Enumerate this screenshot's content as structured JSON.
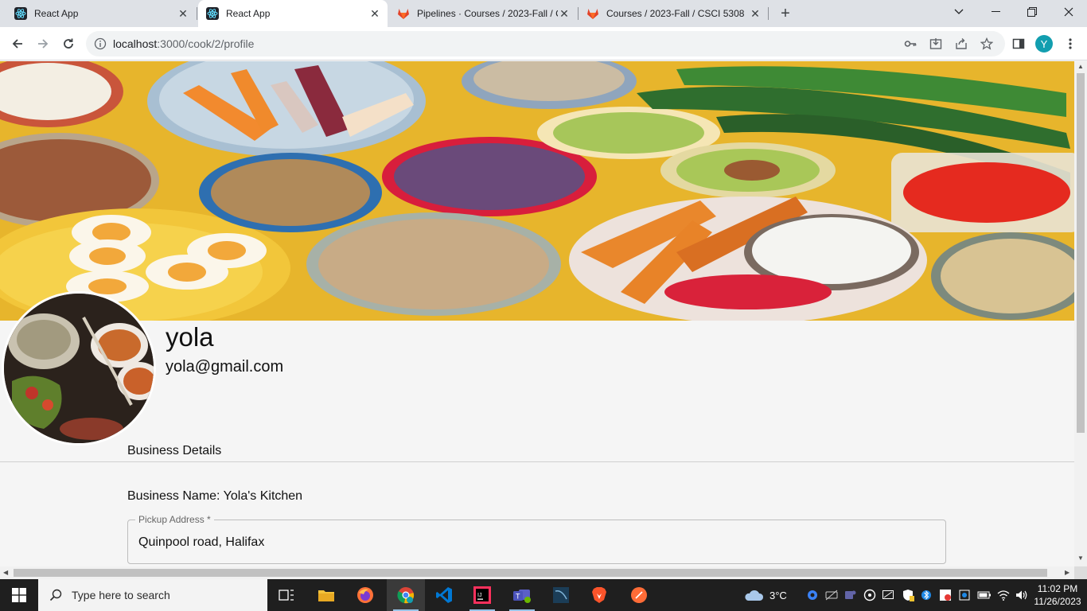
{
  "browser": {
    "tabs": [
      {
        "title": "React App",
        "active": false
      },
      {
        "title": "React App",
        "active": true
      },
      {
        "title": "Pipelines · Courses / 2023-Fall / C",
        "active": false
      },
      {
        "title": "Courses / 2023-Fall / CSCI 5308",
        "active": false
      }
    ],
    "url_host": "localhost",
    "url_path": ":3000/cook/2/profile",
    "profile_initial": "Y"
  },
  "profile": {
    "name": "yola",
    "email": "yola@gmail.com",
    "section_title": "Business Details",
    "business_name_label": "Business Name:",
    "business_name": "Yola's Kitchen",
    "pickup_label": "Pickup Address *",
    "pickup_value": "Quinpool road, Halifax"
  },
  "taskbar": {
    "search_placeholder": "Type here to search",
    "weather": "3°C",
    "time": "11:02 PM",
    "date": "11/26/2023"
  },
  "colors": {
    "accent_teal": "#129eaf",
    "banner_yellow": "#e6b52a"
  }
}
